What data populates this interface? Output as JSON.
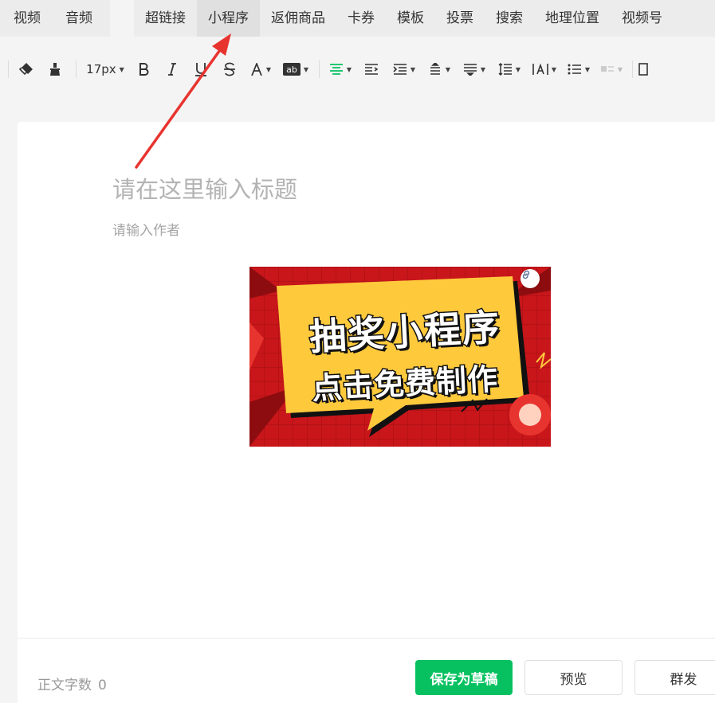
{
  "menu": {
    "group1": [
      "视频",
      "音频"
    ],
    "group2": [
      "超链接",
      "小程序",
      "返佣商品",
      "卡券",
      "模板",
      "投票",
      "搜索",
      "地理位置",
      "视频号"
    ],
    "active": "小程序"
  },
  "toolbar": {
    "font_size": "17px"
  },
  "editor": {
    "title_placeholder": "请在这里输入标题",
    "author_placeholder": "请输入作者",
    "banner": {
      "line1": "抽奖小程序",
      "line2": "点击免费制作"
    }
  },
  "footer": {
    "wordcount_label": "正文字数",
    "wordcount_value": "0",
    "save_draft": "保存为草稿",
    "preview": "预览",
    "mass_send": "群发"
  },
  "colors": {
    "accent": "#07c160",
    "banner_red": "#c8161b",
    "banner_yellow": "#ffc93c",
    "arrow_red": "#e8342f"
  }
}
